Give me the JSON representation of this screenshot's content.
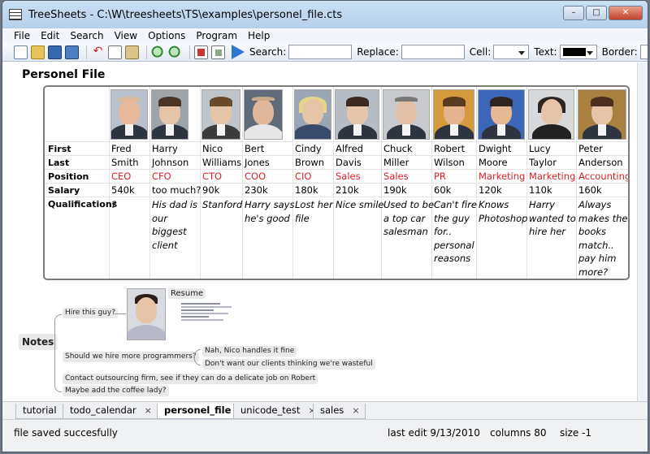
{
  "window": {
    "title": "TreeSheets - C:\\W\\treesheets\\TS\\examples\\personel_file.cts",
    "controls": [
      "minimize-icon",
      "maximize-icon",
      "close-icon"
    ]
  },
  "menu": [
    "File",
    "Edit",
    "Search",
    "View",
    "Options",
    "Program",
    "Help"
  ],
  "toolbar": {
    "search_label": "Search:",
    "search_value": "",
    "replace_label": "Replace:",
    "replace_value": "",
    "cell_label": "Cell:",
    "text_label": "Text:",
    "border_label": "Border:",
    "colors": {
      "cell": "#ffffff",
      "text": "#000000",
      "run": "#2f74d0"
    }
  },
  "document": {
    "title": "Personel File",
    "row_labels": [
      "First",
      "Last",
      "Position",
      "Salary",
      "Qualifications"
    ],
    "people": [
      {
        "first": "Fred",
        "last": "Smith",
        "position": "CEO",
        "salary": "540k",
        "qualifications": "?"
      },
      {
        "first": "Harry",
        "last": "Johnson",
        "position": "CFO",
        "salary": "too much?",
        "qualifications": "His dad is our biggest client"
      },
      {
        "first": "Nico",
        "last": "Williams",
        "position": "CTO",
        "salary": "90k",
        "qualifications": "Stanford"
      },
      {
        "first": "Bert",
        "last": "Jones",
        "position": "COO",
        "salary": "230k",
        "qualifications": "Harry says he's good"
      },
      {
        "first": "Cindy",
        "last": "Brown",
        "position": "CIO",
        "salary": "180k",
        "qualifications": "Lost her file"
      },
      {
        "first": "Alfred",
        "last": "Davis",
        "position": "Sales",
        "salary": "210k",
        "qualifications": "Nice smile"
      },
      {
        "first": "Chuck",
        "last": "Miller",
        "position": "Sales",
        "salary": "190k",
        "qualifications": "Used to be a top car salesman"
      },
      {
        "first": "Robert",
        "last": "Wilson",
        "position": "PR",
        "salary": "60k",
        "qualifications": "Can't fire the guy for.. personal reasons"
      },
      {
        "first": "Dwight",
        "last": "Moore",
        "position": "Marketing",
        "salary": "120k",
        "qualifications": "Knows Photoshop"
      },
      {
        "first": "Lucy",
        "last": "Taylor",
        "position": "Marketing",
        "salary": "110k",
        "qualifications": "Harry wanted to hire her"
      },
      {
        "first": "Peter",
        "last": "Anderson",
        "position": "Accounting",
        "salary": "160k",
        "qualifications": "Always makes the books match.. pay him more?"
      }
    ],
    "position_color": "#d8202a"
  },
  "notes": {
    "label": "Notes",
    "hire": "Hire this guy?",
    "resume": "Resume",
    "programmers": "Should we hire more programmers?",
    "reply1": "Nah, Nico handles it fine",
    "reply2": "Don't want our clients thinking we're wasteful",
    "outsourcing": "Contact outsourcing firm, see if they can do a delicate job on Robert",
    "coffee": "Maybe add the coffee lady?"
  },
  "tabs": [
    {
      "label": "tutorial",
      "active": false
    },
    {
      "label": "todo_calendar",
      "active": false
    },
    {
      "label": "personel_file",
      "active": true
    },
    {
      "label": "unicode_test",
      "active": false
    },
    {
      "label": "sales",
      "active": false
    }
  ],
  "tab_close": "×",
  "status": {
    "message": "file saved succesfully",
    "last_edit": "last edit 9/13/2010",
    "columns": "columns 80",
    "size": "size -1"
  }
}
